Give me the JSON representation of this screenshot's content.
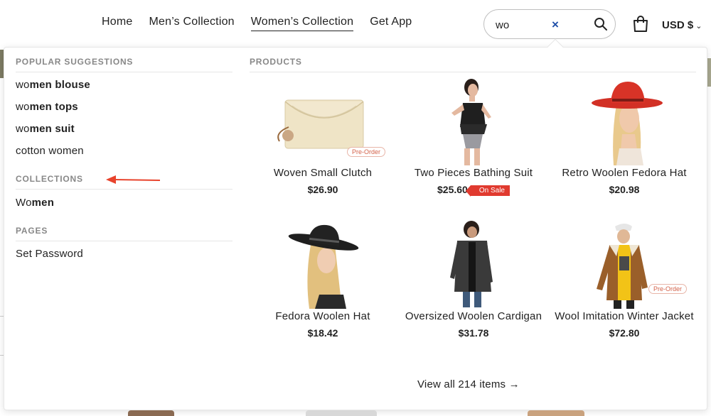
{
  "nav": {
    "items": [
      {
        "label": "Home"
      },
      {
        "label": "Men’s Collection"
      },
      {
        "label": "Women’s Collection"
      },
      {
        "label": "Get App"
      }
    ]
  },
  "search": {
    "value": "wo",
    "clear_icon": "×",
    "icon": "search-icon"
  },
  "currency": {
    "label": "USD $",
    "chevron": "⌄"
  },
  "suggestions": {
    "popular_title": "POPULAR SUGGESTIONS",
    "items": [
      {
        "prefix": "wo",
        "rest": "men blouse"
      },
      {
        "prefix": "wo",
        "rest": "men tops"
      },
      {
        "prefix": "wo",
        "rest": "men suit"
      },
      {
        "text": "cotton women"
      }
    ],
    "collections_title": "COLLECTIONS",
    "collections": [
      {
        "prefix": "Wo",
        "rest": "men"
      }
    ],
    "pages_title": "PAGES",
    "pages": [
      {
        "text": "Set Password"
      }
    ]
  },
  "products": {
    "title": "PRODUCTS",
    "items": [
      {
        "name": "Woven Small Clutch",
        "price": "$26.90",
        "badge": "Pre-Order"
      },
      {
        "name": "Two Pieces Bathing Suit",
        "price": "$25.60",
        "sale": "On Sale"
      },
      {
        "name": "Retro Woolen Fedora Hat",
        "price": "$20.98"
      },
      {
        "name": "Fedora Woolen Hat",
        "price": "$18.42"
      },
      {
        "name": "Oversized Woolen Cardigan",
        "price": "$31.78"
      },
      {
        "name": "Wool Imitation Winter Jacket",
        "price": "$72.80",
        "badge": "Pre-Order"
      }
    ],
    "view_all": "View all 214 items",
    "view_all_arrow": "→"
  },
  "colors": {
    "accent_arrow": "#e8432c",
    "sale_red": "#e03a2f",
    "badge_text": "#d3624a",
    "clear_blue": "#1f4fa8"
  }
}
